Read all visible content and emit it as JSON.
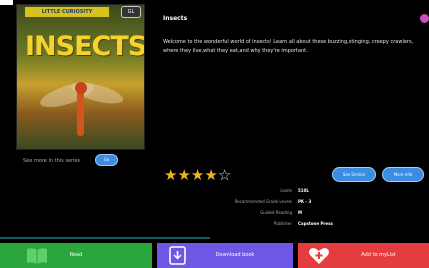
{
  "book": {
    "title": "Insects",
    "description": "Welcome to the wonderful world of insects! Learn all about these buzzing,stinging, creepy crawlers, where they live,what they eat,and why they're important.",
    "rating": 4,
    "rating_max": 5
  },
  "cover": {
    "series_banner": "LITTLE CURIOSITY",
    "series_sub": "",
    "title": "INSECTS",
    "guided_reading_badge": "GL",
    "author": ""
  },
  "series_link": {
    "label": "See more in this series",
    "button": "Go"
  },
  "actions": {
    "similar_books": "See Similar",
    "more_info": "More Info",
    "read": "Read",
    "download": "Download book",
    "add_to_list": "Add to myList"
  },
  "details": [
    {
      "label": "Lexile",
      "value": "510L"
    },
    {
      "label": "Recommended Grade Levels",
      "value": "PK - 3"
    },
    {
      "label": "Guided Reading",
      "value": "M"
    },
    {
      "label": "Publisher",
      "value": "Capstone Press"
    }
  ],
  "colors": {
    "read": "#2aa63c",
    "download": "#6f57e6",
    "add": "#e53d3f",
    "star": "#f0b21d",
    "pill": "#3a8de0"
  }
}
